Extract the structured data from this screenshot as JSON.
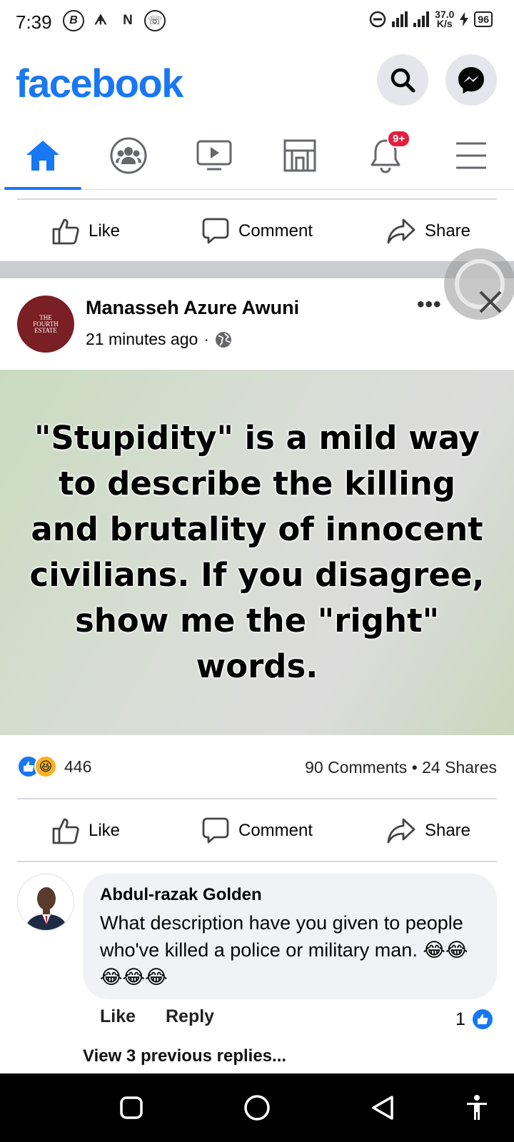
{
  "status_bar": {
    "time": "7:39",
    "left_icons": [
      "B",
      "ᗗ",
      "N",
      "☏"
    ],
    "network_speed": "37.0",
    "network_unit": "K/s",
    "battery": "96"
  },
  "header": {
    "logo": "facebook",
    "brand_color": "#1877f2",
    "search_icon": "search-icon",
    "messenger_icon": "messenger-icon"
  },
  "tabs": {
    "items": [
      "home",
      "groups",
      "watch",
      "marketplace",
      "notifications",
      "menu"
    ],
    "active": "home",
    "notification_badge": "9+"
  },
  "prev_post_actions": {
    "like": "Like",
    "comment": "Comment",
    "share": "Share"
  },
  "post": {
    "author": "Manasseh Azure Awuni",
    "time": "21 minutes ago",
    "separator": "·",
    "avatar_text_line1": "THE",
    "avatar_text_line2": "FOURTH",
    "avatar_text_line3": "ESTATE",
    "quote": "\"Stupidity\" is a mild way to describe the killing and brutality of innocent civilians. If you disagree, show me the \"right\" words.",
    "reaction_count": "446",
    "comments_shares": "90 Comments • 24 Shares",
    "actions": {
      "like": "Like",
      "comment": "Comment",
      "share": "Share"
    }
  },
  "comment": {
    "name": "Abdul-razak Golden",
    "text": "What description have you given to people who've killed a police or military man. 😂😂😂😂😂",
    "like": "Like",
    "reply": "Reply",
    "like_count": "1",
    "view_previous": "View 3 previous replies..."
  }
}
